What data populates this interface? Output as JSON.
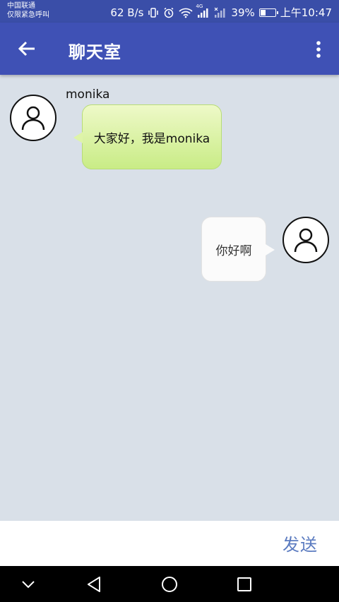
{
  "status_bar": {
    "carrier_line1": "中国联通",
    "carrier_line2": "仅限紧急呼叫",
    "speed": "62 B/s",
    "battery": "39%",
    "battery_level": 0.39,
    "network_badge": "4G",
    "time": "上午10:47",
    "icons": [
      "vibrate-icon",
      "alarm-icon",
      "wifi-icon",
      "signal-icon",
      "signal-off-icon",
      "battery-icon"
    ]
  },
  "app_bar": {
    "title": "聊天室",
    "back_icon": "arrow-left-icon",
    "menu_icon": "more-vertical-icon"
  },
  "messages": [
    {
      "sender": "monika",
      "side": "left",
      "text": "大家好，我是monika"
    },
    {
      "sender": "",
      "side": "right",
      "text": "你好啊"
    }
  ],
  "input_bar": {
    "message_value": "",
    "send_label": "发送"
  },
  "nav_bar": {
    "icons": [
      "chevron-down-icon",
      "back-triangle-icon",
      "home-circle-icon",
      "recents-square-icon"
    ]
  },
  "colors": {
    "status_bar": "#3a4ea8",
    "app_bar": "#3f51b5",
    "chat_background": "#d9e0e8",
    "bubble_left": "#d6f09a",
    "bubble_right": "#fbfbfb",
    "send_text": "#5b7bc0"
  }
}
